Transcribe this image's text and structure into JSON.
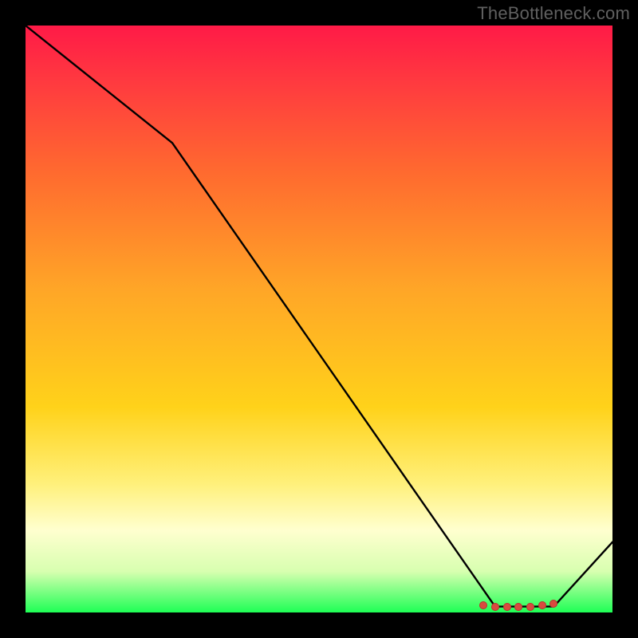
{
  "attribution": "TheBottleneck.com",
  "chart_data": {
    "type": "line",
    "title": "",
    "xlabel": "",
    "ylabel": "",
    "xlim": [
      0,
      100
    ],
    "ylim": [
      0,
      100
    ],
    "grid": false,
    "series": [
      {
        "name": "curve",
        "x": [
          0,
          25,
          80,
          90,
          100
        ],
        "values": [
          100,
          80,
          1,
          1,
          12
        ]
      }
    ],
    "markers": {
      "x": [
        78,
        80,
        82,
        84,
        86,
        88,
        90
      ],
      "values": [
        1.2,
        1,
        1,
        1,
        1,
        1.2,
        1.5
      ]
    },
    "background_gradient": [
      "#ff1a47",
      "#ffd21a",
      "#1eff55"
    ]
  }
}
